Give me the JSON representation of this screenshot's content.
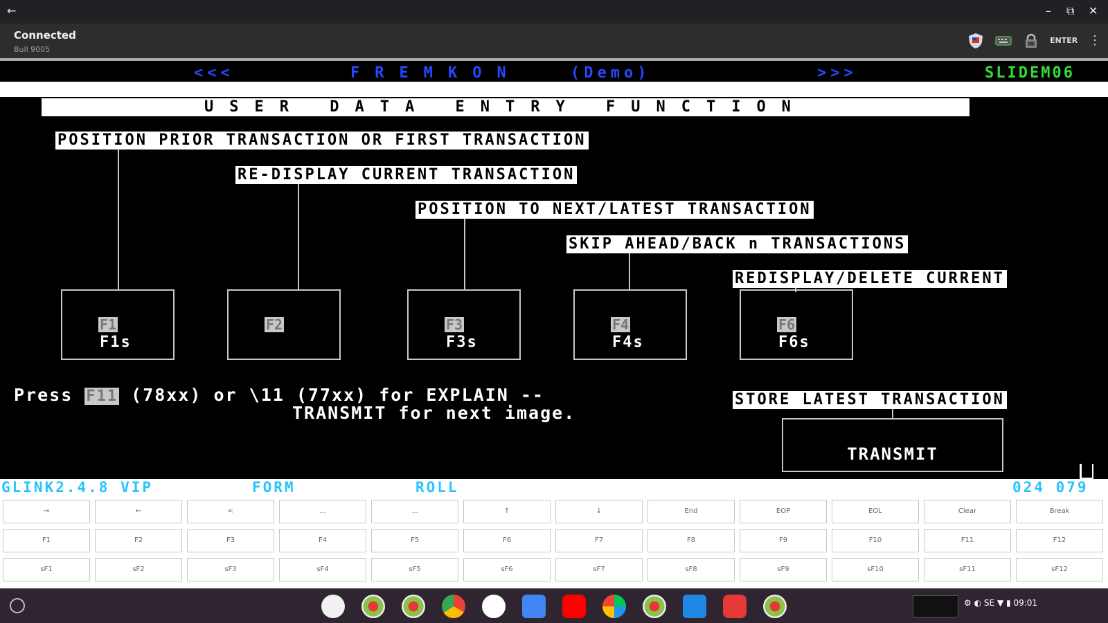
{
  "window": {
    "back_glyph": "←",
    "minimize_glyph": "–",
    "restore_glyph": "⧉",
    "close_glyph": "✕"
  },
  "app": {
    "status": "Connected",
    "host": "Bull 9005",
    "enter_label": "ENTER",
    "kebab_glyph": "⋮"
  },
  "terminal": {
    "nav_prev": "<<<",
    "product": "FREMKON",
    "demo": "(Demo)",
    "nav_next": ">>>",
    "slide": "SLIDEM06",
    "title": "USER DATA ENTRY FUNCTION",
    "labels": {
      "l1": "POSITION PRIOR TRANSACTION OR FIRST TRANSACTION",
      "l2": "RE-DISPLAY CURRENT TRANSACTION",
      "l3": "POSITION TO NEXT/LATEST TRANSACTION",
      "l4": "SKIP AHEAD/BACK n TRANSACTIONS",
      "l5": "REDISPLAY/DELETE CURRENT",
      "l6": "STORE LATEST TRANSACTION"
    },
    "boxes": [
      {
        "key": "F1",
        "shift": "F1s"
      },
      {
        "key": "F2",
        "shift": ""
      },
      {
        "key": "F3",
        "shift": "F3s"
      },
      {
        "key": "F4",
        "shift": "F4s"
      },
      {
        "key": "F6",
        "shift": "F6s"
      }
    ],
    "press": {
      "pre": "Press",
      "key": "F11",
      "mid": "(78xx) or \\11 (77xx) for EXPLAIN --",
      "line2": "TRANSMIT for next image."
    },
    "transmit": "TRANSMIT"
  },
  "status_bar": {
    "product": "GLINK2.4.8 VIP",
    "mode": "FORM",
    "roll": "ROLL",
    "pos": "024 079"
  },
  "keypad": {
    "row1": [
      "→",
      "←",
      "<",
      "...",
      "...",
      "↑",
      "↓",
      "End",
      "EOP",
      "EOL",
      "Clear",
      "Break"
    ],
    "row2": [
      "F1",
      "F2",
      "F3",
      "F4",
      "F5",
      "F6",
      "F7",
      "F8",
      "F9",
      "F10",
      "F11",
      "F12"
    ],
    "row3": [
      "sF1",
      "sF2",
      "sF3",
      "sF4",
      "sF5",
      "sF6",
      "sF7",
      "sF8",
      "sF9",
      "sF10",
      "sF11",
      "sF12"
    ]
  },
  "tray": {
    "locale": "SE",
    "time": "09:01"
  },
  "colors": {
    "nav_blue": "#2747ff",
    "slide_green": "#33dd33",
    "status_cyan": "#27c4ff"
  }
}
